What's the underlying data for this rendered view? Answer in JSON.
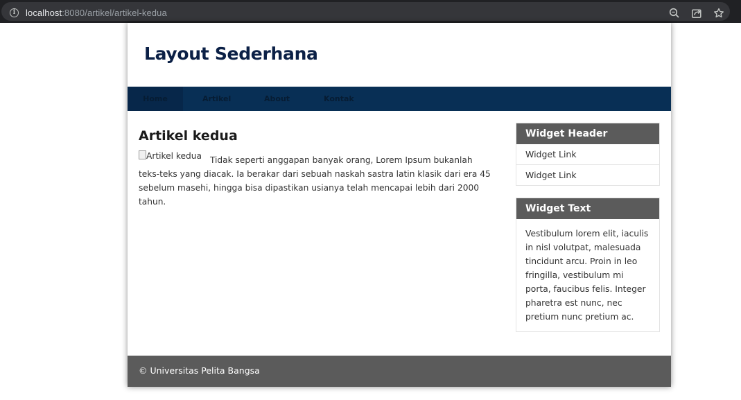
{
  "browser": {
    "url_host": "localhost",
    "url_path": ":8080/artikel/artikel-kedua",
    "icons": [
      "info-icon",
      "zoom-icon",
      "share-icon",
      "bookmark-star-icon"
    ]
  },
  "site": {
    "title": "Layout Sederhana"
  },
  "nav": {
    "items": [
      {
        "label": "Home",
        "active": true
      },
      {
        "label": "Artikel",
        "active": false
      },
      {
        "label": "About",
        "active": false
      },
      {
        "label": "Kontak",
        "active": false
      }
    ]
  },
  "article": {
    "title": "Artikel kedua",
    "image_alt": "Artikel kedua",
    "body": "Tidak seperti anggapan banyak orang, Lorem Ipsum bukanlah teks-teks yang diacak. Ia berakar dari sebuah naskah sastra latin klasik dari era 45 sebelum masehi, hingga bisa dipastikan usianya telah mencapai lebih dari 2000 tahun."
  },
  "sidebar": {
    "widget_links": {
      "header": "Widget Header",
      "links": [
        "Widget Link",
        "Widget Link"
      ]
    },
    "widget_text": {
      "header": "Widget Text",
      "text": "Vestibulum lorem elit, iaculis in nisl volutpat, malesuada tincidunt arcu. Proin in leo fringilla, vestibulum mi porta, faucibus felis. Integer pharetra est nunc, nec pretium nunc pretium ac."
    }
  },
  "footer": {
    "text": "© Universitas Pelita Bangsa"
  },
  "colors": {
    "header_text": "#0b2046",
    "nav_bg": "#082f55",
    "widget_header_bg": "#5b5b5b",
    "footer_bg": "#5b5b5b"
  }
}
